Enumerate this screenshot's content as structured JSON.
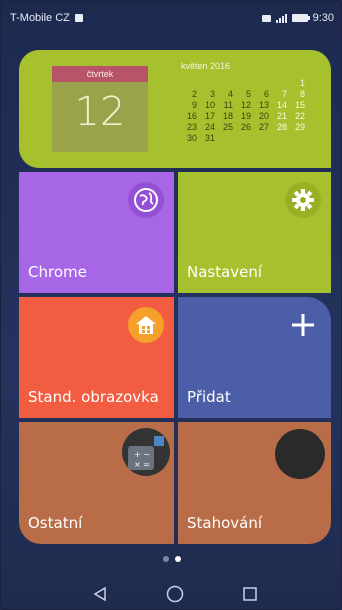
{
  "status_bar": {
    "carrier": "T-Mobile CZ",
    "time": "9:30"
  },
  "calendar": {
    "weekday": "čtvrtek",
    "day": "12",
    "month_title": "květen 2016",
    "weeks": [
      [
        "",
        "",
        "",
        "",
        "",
        "",
        "1"
      ],
      [
        "2",
        "3",
        "4",
        "5",
        "6",
        "7",
        "8"
      ],
      [
        "9",
        "10",
        "11",
        "12",
        "13",
        "14",
        "15"
      ],
      [
        "16",
        "17",
        "18",
        "19",
        "20",
        "21",
        "22"
      ],
      [
        "23",
        "24",
        "25",
        "26",
        "27",
        "28",
        "29"
      ],
      [
        "30",
        "31",
        "",
        "",
        "",
        "",
        ""
      ]
    ]
  },
  "tiles": {
    "chrome": {
      "label": "Chrome",
      "color": "#a766e6",
      "icon": "globe-icon"
    },
    "settings": {
      "label": "Nastavení",
      "color": "#a7c12e",
      "icon": "gear-icon"
    },
    "home": {
      "label": "Stand. obrazovka",
      "color": "#f25c41",
      "icon": "home-icon"
    },
    "add": {
      "label": "Přidat",
      "color": "#4d5ea8",
      "icon": "plus-icon"
    },
    "other": {
      "label": "Ostatní",
      "color": "#b86d48",
      "icon": "calculator-icon"
    },
    "download": {
      "label": "Stahování",
      "color": "#b86d48",
      "icon": "download-icon"
    }
  },
  "page_indicator": {
    "pages": 2,
    "current": 2
  },
  "nav_bar": {
    "buttons": [
      "back-icon",
      "home-circle-icon",
      "recents-icon"
    ]
  }
}
